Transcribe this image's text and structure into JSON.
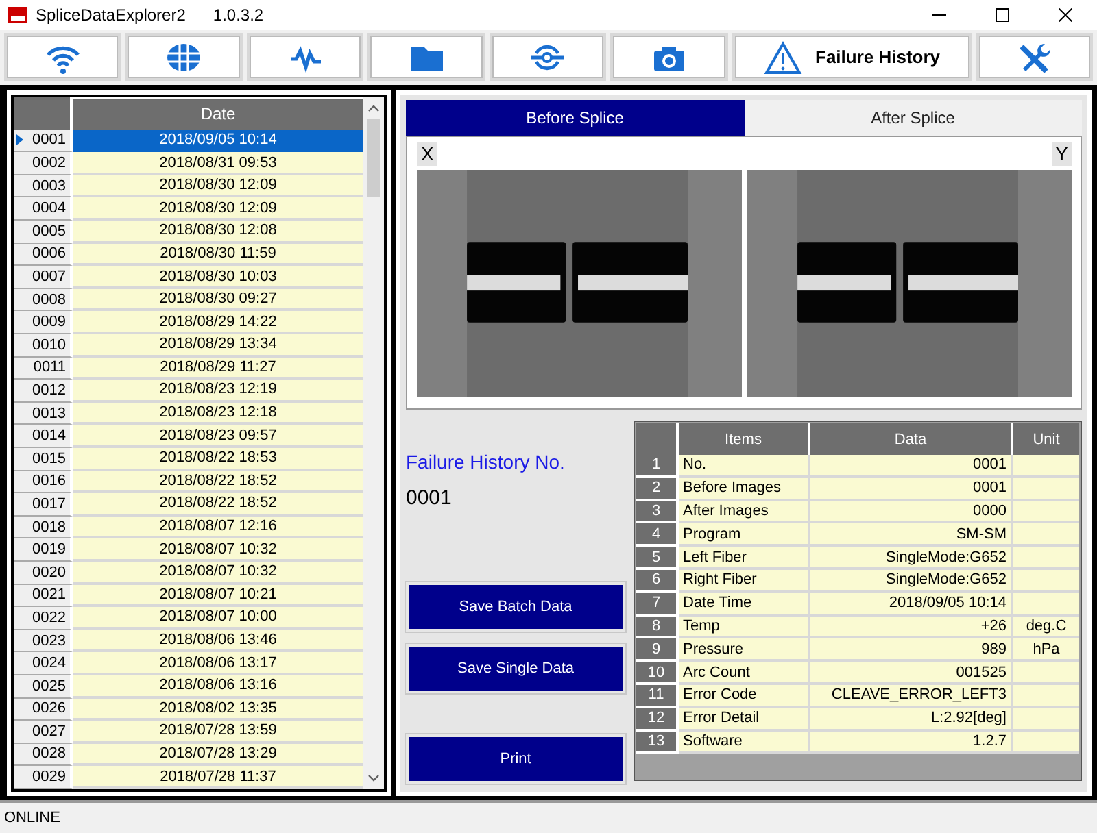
{
  "window": {
    "title": "SpliceDataExplorer2",
    "version": "1.0.3.2"
  },
  "toolbar": [
    {
      "kind": "wifi"
    },
    {
      "kind": "splicer"
    },
    {
      "kind": "wave"
    },
    {
      "kind": "folder"
    },
    {
      "kind": "connector"
    },
    {
      "kind": "camera"
    },
    {
      "kind": "warning",
      "label": "Failure History"
    },
    {
      "kind": "tools"
    }
  ],
  "history_list": {
    "columns": [
      "Date"
    ],
    "rows": [
      {
        "no": "0001",
        "date": "2018/09/05 10:14",
        "selected": true
      },
      {
        "no": "0002",
        "date": "2018/08/31 09:53",
        "selected": false
      },
      {
        "no": "0003",
        "date": "2018/08/30 12:09",
        "selected": false
      },
      {
        "no": "0004",
        "date": "2018/08/30 12:09",
        "selected": false
      },
      {
        "no": "0005",
        "date": "2018/08/30 12:08",
        "selected": false
      },
      {
        "no": "0006",
        "date": "2018/08/30 11:59",
        "selected": false
      },
      {
        "no": "0007",
        "date": "2018/08/30 10:03",
        "selected": false
      },
      {
        "no": "0008",
        "date": "2018/08/30 09:27",
        "selected": false
      },
      {
        "no": "0009",
        "date": "2018/08/29 14:22",
        "selected": false
      },
      {
        "no": "0010",
        "date": "2018/08/29 13:34",
        "selected": false
      },
      {
        "no": "0011",
        "date": "2018/08/29 11:27",
        "selected": false
      },
      {
        "no": "0012",
        "date": "2018/08/23 12:19",
        "selected": false
      },
      {
        "no": "0013",
        "date": "2018/08/23 12:18",
        "selected": false
      },
      {
        "no": "0014",
        "date": "2018/08/23 09:57",
        "selected": false
      },
      {
        "no": "0015",
        "date": "2018/08/22 18:53",
        "selected": false
      },
      {
        "no": "0016",
        "date": "2018/08/22 18:52",
        "selected": false
      },
      {
        "no": "0017",
        "date": "2018/08/22 18:52",
        "selected": false
      },
      {
        "no": "0018",
        "date": "2018/08/07 12:16",
        "selected": false
      },
      {
        "no": "0019",
        "date": "2018/08/07 10:32",
        "selected": false
      },
      {
        "no": "0020",
        "date": "2018/08/07 10:32",
        "selected": false
      },
      {
        "no": "0021",
        "date": "2018/08/07 10:21",
        "selected": false
      },
      {
        "no": "0022",
        "date": "2018/08/07 10:00",
        "selected": false
      },
      {
        "no": "0023",
        "date": "2018/08/06 13:46",
        "selected": false
      },
      {
        "no": "0024",
        "date": "2018/08/06 13:17",
        "selected": false
      },
      {
        "no": "0025",
        "date": "2018/08/06 13:16",
        "selected": false
      },
      {
        "no": "0026",
        "date": "2018/08/02 13:35",
        "selected": false
      },
      {
        "no": "0027",
        "date": "2018/07/28 13:59",
        "selected": false
      },
      {
        "no": "0028",
        "date": "2018/07/28 13:29",
        "selected": false
      },
      {
        "no": "0029",
        "date": "2018/07/28 11:37",
        "selected": false
      }
    ]
  },
  "image_tabs": [
    {
      "label": "Before Splice",
      "selected": true
    },
    {
      "label": "After Splice",
      "selected": false
    }
  ],
  "image_view": {
    "left_label": "X",
    "right_label": "Y"
  },
  "detail": {
    "title": "Failure History No.",
    "number": "0001"
  },
  "buttons": [
    "Save Batch Data",
    "Save Single Data",
    "Print"
  ],
  "detail_table": {
    "columns": [
      "Items",
      "Data",
      "Unit"
    ],
    "rows": [
      {
        "index": "1",
        "item": "No.",
        "data": "0001"
      },
      {
        "index": "2",
        "item": "Before Images",
        "data": "0001"
      },
      {
        "index": "3",
        "item": "After Images",
        "data": "0000"
      },
      {
        "index": "4",
        "item": "Program",
        "data": "SM-SM"
      },
      {
        "index": "5",
        "item": "Left Fiber",
        "data": "SingleMode:G652"
      },
      {
        "index": "6",
        "item": "Right Fiber",
        "data": "SingleMode:G652"
      },
      {
        "index": "7",
        "item": "Date Time",
        "data": "2018/09/05 10:14"
      },
      {
        "index": "8",
        "item": "Temp",
        "data": "+26",
        "unit": "deg.C"
      },
      {
        "index": "9",
        "item": "Pressure",
        "data": "989",
        "unit": "hPa"
      },
      {
        "index": "10",
        "item": "Arc Count",
        "data": "001525"
      },
      {
        "index": "11",
        "item": "Error Code",
        "data": "CLEAVE_ERROR_LEFT3"
      },
      {
        "index": "12",
        "item": "Error Detail",
        "data": "L:2.92[deg]"
      },
      {
        "index": "13",
        "item": "Software",
        "data": "1.2.7"
      }
    ]
  },
  "status_bar": "ONLINE"
}
